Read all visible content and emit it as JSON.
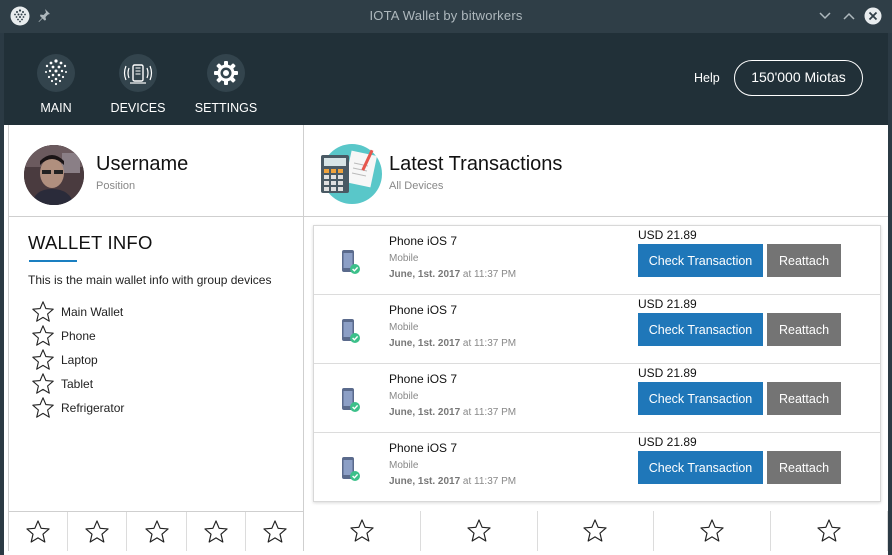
{
  "window": {
    "title": "IOTA Wallet by bitworkers"
  },
  "nav": {
    "items": [
      {
        "label": "MAIN",
        "icon": "iota-logo-icon"
      },
      {
        "label": "DEVICES",
        "icon": "devices-icon"
      },
      {
        "label": "SETTINGS",
        "icon": "gear-icon"
      }
    ],
    "help": "Help",
    "balance": "150'000 Miotas"
  },
  "profile": {
    "name": "Username",
    "position": "Position"
  },
  "wallet": {
    "title": "WALLET INFO",
    "description": "This is the main wallet info with group devices",
    "groups": [
      "Main Wallet",
      "Phone",
      "Laptop",
      "Tablet",
      "Refrigerator"
    ]
  },
  "transactions": {
    "title": "Latest Transactions",
    "subtitle": "All Devices",
    "check_label": "Check Transaction",
    "reattach_label": "Reattach",
    "items": [
      {
        "device": "Phone iOS 7",
        "type": "Mobile",
        "date": "June, 1st. 2017",
        "time": " at 11:37 PM",
        "amount": "USD 21.89"
      },
      {
        "device": "Phone iOS 7",
        "type": "Mobile",
        "date": "June, 1st. 2017",
        "time": " at 11:37 PM",
        "amount": "USD 21.89"
      },
      {
        "device": "Phone iOS 7",
        "type": "Mobile",
        "date": "June, 1st. 2017",
        "time": " at 11:37 PM",
        "amount": "USD 21.89"
      },
      {
        "device": "Phone iOS 7",
        "type": "Mobile",
        "date": "June, 1st. 2017",
        "time": " at 11:37 PM",
        "amount": "USD 21.89"
      }
    ]
  },
  "colors": {
    "header_bg": "#213038",
    "primary_button": "#1f77b9",
    "secondary_button": "#747474"
  }
}
